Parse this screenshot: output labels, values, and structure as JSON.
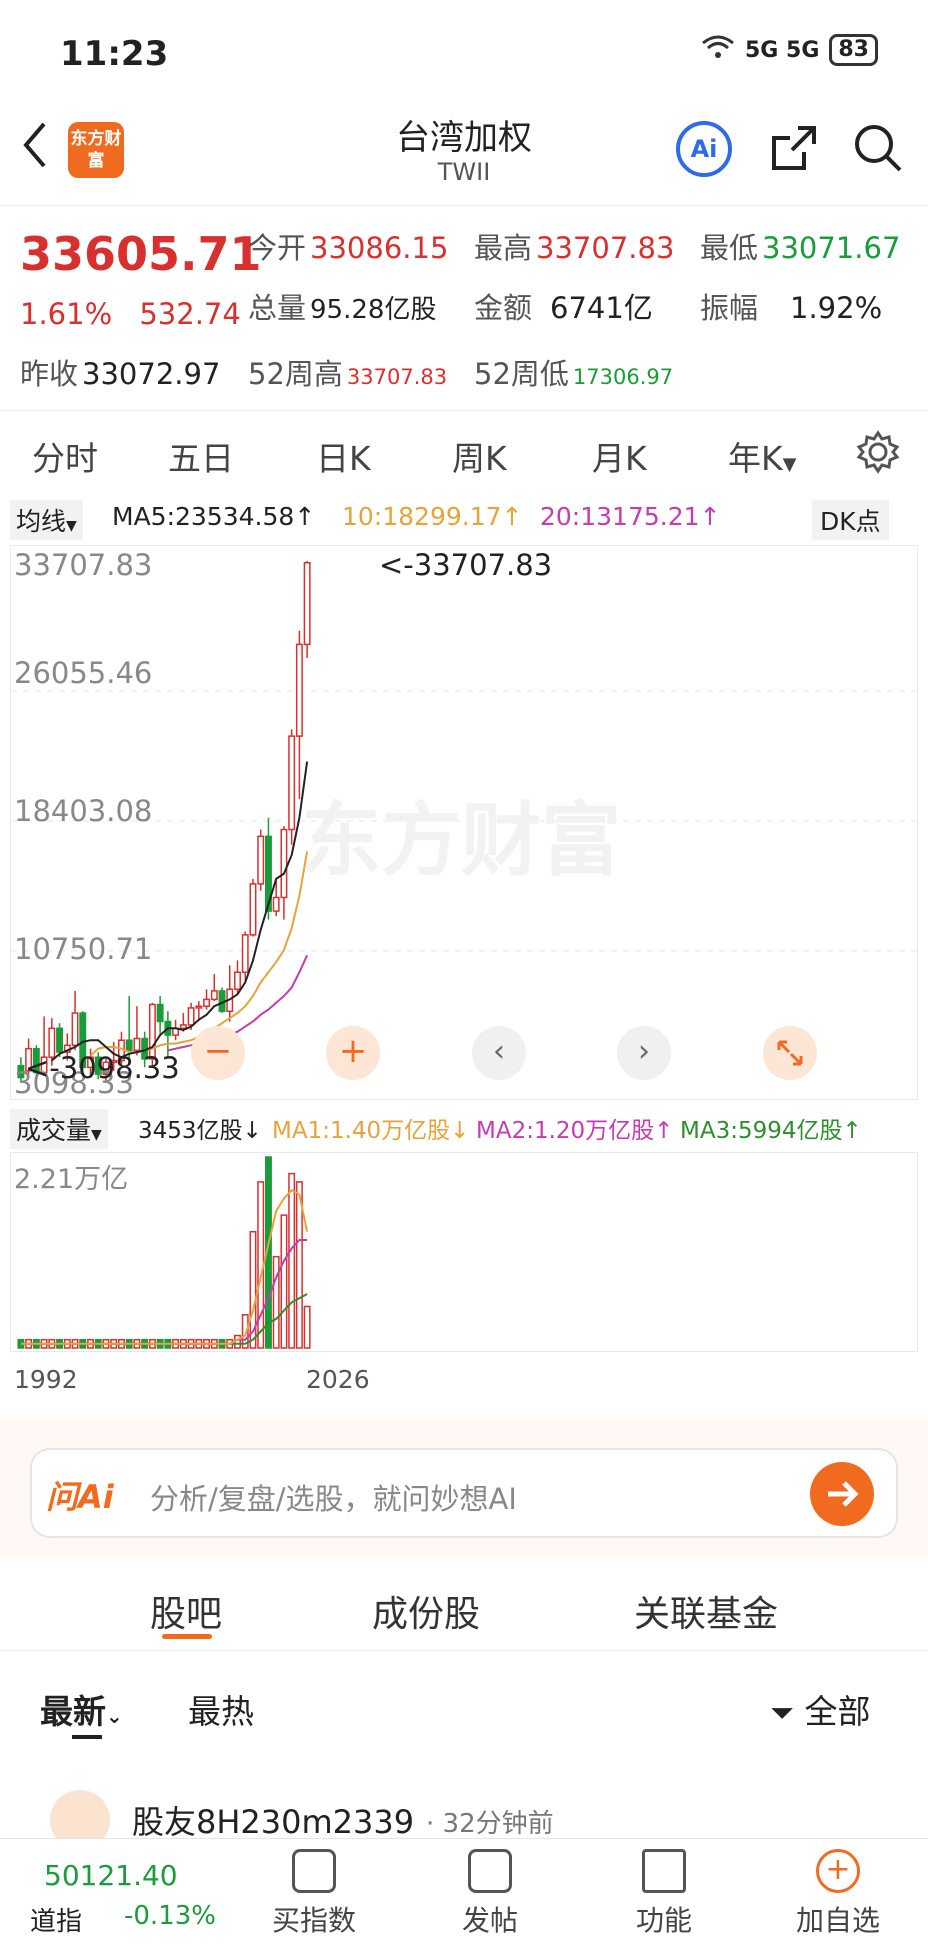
{
  "status_bar": {
    "time": "11:23",
    "network": "5G 5G",
    "battery": "83"
  },
  "header": {
    "title": "台湾加权",
    "subtitle": "TWII",
    "logo_text": "东方财富",
    "ai_label": "Ai"
  },
  "quote": {
    "price": "33605.71",
    "change_pct": "1.61%",
    "change": "532.74",
    "open_label": "今开",
    "open": "33086.15",
    "high_label": "最高",
    "high": "33707.83",
    "low_label": "最低",
    "low": "33071.67",
    "volume_label": "总量",
    "volume": "95.28亿股",
    "amount_label": "金额",
    "amount": "6741亿",
    "amplitude_label": "振幅",
    "amplitude": "1.92%",
    "prev_close_label": "昨收",
    "prev_close": "33072.97",
    "w52_high_label": "52周高",
    "w52_high": "33707.83",
    "w52_low_label": "52周低",
    "w52_low": "17306.97"
  },
  "tabs": [
    "分时",
    "五日",
    "日K",
    "周K",
    "月K",
    "年K"
  ],
  "chart_controls": {
    "ma_selector": "均线",
    "ma5": "MA5:23534.58↑",
    "ma10": "10:18299.17↑",
    "ma20": "20:13175.21↑",
    "dk_button": "DK点",
    "high_marker": "<-33707.83",
    "low_marker": "<-3098.33"
  },
  "chart_data": {
    "type": "candlestick",
    "y_ticks": [
      "33707.83",
      "26055.46",
      "18403.08",
      "10750.71",
      "3098.33"
    ],
    "ylim": [
      3098.33,
      33707.83
    ],
    "candles": [
      [
        4000,
        3300,
        4500,
        3100
      ],
      [
        3700,
        5000,
        5600,
        3500
      ],
      [
        5000,
        3600,
        5200,
        3300
      ],
      [
        3600,
        4500,
        6900,
        3400
      ],
      [
        4500,
        6200,
        6800,
        4000
      ],
      [
        6200,
        4800,
        6500,
        4500
      ],
      [
        4800,
        5200,
        5900,
        4300
      ],
      [
        5200,
        7100,
        8400,
        4900
      ],
      [
        7100,
        3900,
        7200,
        3600
      ],
      [
        3900,
        4500,
        5000,
        3300
      ],
      [
        4500,
        3500,
        4800,
        3200
      ],
      [
        3500,
        4200,
        4500,
        3100
      ],
      [
        4200,
        4300,
        5400,
        3700
      ],
      [
        4300,
        5500,
        6000,
        4000
      ],
      [
        5500,
        4900,
        8100,
        4100
      ],
      [
        4900,
        5600,
        7500,
        4600
      ],
      [
        5600,
        4400,
        6000,
        3900
      ],
      [
        4400,
        7600,
        7700,
        4000
      ],
      [
        7600,
        6600,
        8100,
        5800
      ],
      [
        6600,
        5800,
        7200,
        4500
      ],
      [
        5800,
        6200,
        6700,
        5500
      ],
      [
        6200,
        6400,
        7100,
        6000
      ],
      [
        6400,
        7400,
        7700,
        6100
      ],
      [
        7400,
        7500,
        7800,
        6700
      ],
      [
        7500,
        7900,
        8500,
        7300
      ],
      [
        7900,
        8400,
        9400,
        7800
      ],
      [
        8400,
        7200,
        8600,
        7100
      ],
      [
        7200,
        8500,
        9900,
        6600
      ],
      [
        8500,
        9500,
        10200,
        8200
      ],
      [
        9500,
        11700,
        11900,
        9000
      ],
      [
        11700,
        14700,
        15000,
        11600
      ],
      [
        14700,
        17500,
        17900,
        14300
      ],
      [
        17500,
        13100,
        18600,
        12600
      ],
      [
        13100,
        13900,
        14900,
        12800
      ],
      [
        13900,
        17900,
        18100,
        12600
      ],
      [
        17900,
        23400,
        23800,
        17000
      ],
      [
        23400,
        28800,
        29600,
        19700
      ],
      [
        28800,
        33606,
        33708,
        28000
      ]
    ],
    "ma5": [
      null,
      null,
      null,
      null,
      4300,
      4700,
      4900,
      5100,
      5400,
      5500,
      5500,
      5100,
      4700,
      4500,
      4700,
      4800,
      4900,
      5100,
      5800,
      6200,
      6200,
      6100,
      6300,
      6700,
      7000,
      7500,
      7700,
      7900,
      8200,
      8900,
      10200,
      12000,
      13500,
      15000,
      15300,
      16400,
      18600,
      21900
    ],
    "ma10": [
      null,
      null,
      null,
      null,
      null,
      null,
      null,
      null,
      null,
      4600,
      5000,
      5100,
      5100,
      5000,
      4800,
      4800,
      4900,
      5000,
      5200,
      5300,
      5300,
      5400,
      5500,
      5700,
      5900,
      6200,
      6500,
      6800,
      7100,
      7500,
      8100,
      8900,
      9500,
      10100,
      10800,
      12100,
      14000,
      16600
    ],
    "ma20": [
      null,
      null,
      null,
      null,
      null,
      null,
      null,
      null,
      null,
      null,
      null,
      null,
      null,
      null,
      null,
      null,
      null,
      null,
      null,
      4900,
      5000,
      5100,
      5200,
      5300,
      5400,
      5500,
      5600,
      5800,
      6000,
      6300,
      6600,
      7000,
      7300,
      7700,
      8100,
      8600,
      9500,
      10500
    ],
    "volume": {
      "y_tick": "2.21万亿",
      "bars": [
        2,
        2,
        2,
        2,
        2,
        2,
        2,
        2,
        2,
        2,
        2,
        2,
        2,
        2,
        2,
        2,
        2,
        2,
        2,
        2,
        2,
        2,
        2,
        2,
        2,
        2,
        2,
        2,
        3,
        8,
        28,
        40,
        46,
        22,
        32,
        42,
        40,
        10
      ],
      "ma1": [
        1,
        1,
        1,
        1,
        1,
        1,
        1,
        1,
        1,
        1,
        1,
        1,
        1,
        1,
        1,
        1,
        1,
        1,
        1,
        1,
        1,
        1,
        1,
        1,
        1,
        1,
        1,
        1,
        2,
        3,
        9,
        17,
        25,
        33,
        36,
        38,
        37,
        28
      ],
      "ma2": [
        1,
        1,
        1,
        1,
        1,
        1,
        1,
        1,
        1,
        1,
        1,
        1,
        1,
        1,
        1,
        1,
        1,
        1,
        1,
        1,
        1,
        1,
        1,
        1,
        1,
        1,
        1,
        1,
        2,
        2,
        4,
        8,
        12,
        17,
        21,
        24,
        26,
        26
      ],
      "ma3": [
        1,
        1,
        1,
        1,
        1,
        1,
        1,
        1,
        1,
        1,
        1,
        1,
        1,
        1,
        1,
        1,
        1,
        1,
        1,
        1,
        1,
        1,
        1,
        1,
        1,
        1,
        1,
        1,
        1,
        1,
        2,
        4,
        6,
        7,
        9,
        11,
        12,
        13
      ]
    },
    "x_ticks": [
      "1992",
      "2026"
    ]
  },
  "volume_controls": {
    "selector": "成交量",
    "current": "3453亿股↓",
    "ma1": "MA1:1.40万亿股↓",
    "ma2": "MA2:1.20万亿股↑",
    "ma3": "MA3:5994亿股↑"
  },
  "ai_bar": {
    "brand": "问Ai",
    "placeholder": "分析/复盘/选股，就问妙想AI"
  },
  "section_tabs": [
    "股吧",
    "成份股",
    "关联基金"
  ],
  "filter": {
    "latest": "最新",
    "hot": "最热",
    "all": "全部"
  },
  "post": {
    "user": "股友8H230m2339",
    "time": "· 32分钟前"
  },
  "bottom_bar": {
    "ticker_value": "50121.40",
    "ticker_name": "道指",
    "ticker_change": "-0.13%",
    "items": [
      "买指数",
      "发帖",
      "功能",
      "加自选"
    ]
  },
  "colors": {
    "up": "#d7302f",
    "down": "#1a9c3a",
    "accent": "#f06a1f",
    "ma5": "#222222",
    "ma10": "#e8a23a",
    "ma20": "#c43cb0",
    "vma1": "#e8a23a",
    "vma2": "#c43cb0",
    "vma3": "#2f8f2f"
  }
}
